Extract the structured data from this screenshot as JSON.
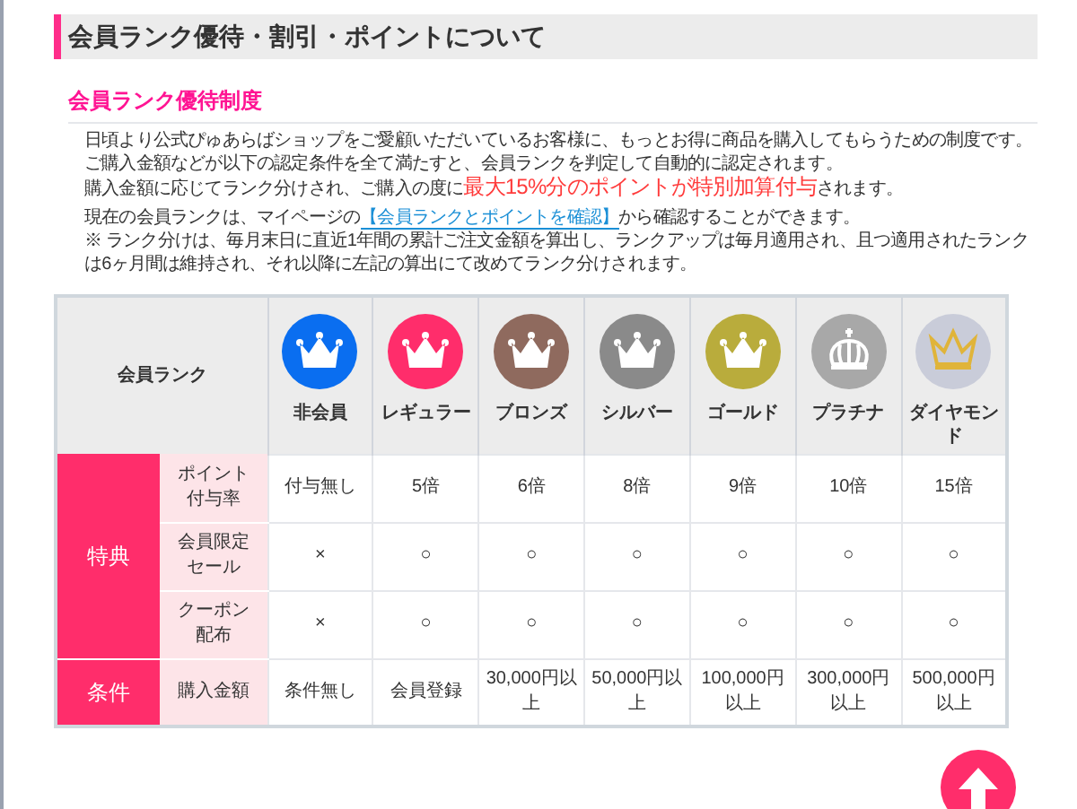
{
  "page_title": "会員ランク優待・割引・ポイントについて",
  "section_heading": "会員ランク優待制度",
  "paragraphs": [
    {
      "kind": "plain",
      "text": "日頃より公式ぴゅあらばショップをご愛顧いただいているお客様に、もっとお得に商品を購入してもらうための制度です。"
    },
    {
      "kind": "plain",
      "text": "ご購入金額などが以下の認定条件を全て満たすと、会員ランクを判定して自動的に認定されます。"
    },
    {
      "kind": "highlight",
      "before": "購入金額に応じてランク分けされ、ご購入の度に",
      "highlight": "最大15%分のポイントが特別加算付与",
      "after": "されます。"
    },
    {
      "kind": "link",
      "before": "現在の会員ランクは、マイページの",
      "link": "【会員ランクとポイントを確認】",
      "after": "から確認することができます。"
    },
    {
      "kind": "plain",
      "text": "※ ランク分けは、毎月末日に直近1年間の累計ご注文金額を算出し、ランクアップは毎月適用され、且つ適用されたランクは6ヶ月間は維持され、それ以降に左記の算出にて改めてランク分けされます。"
    }
  ],
  "table": {
    "corner": "会員ランク",
    "ranks": [
      {
        "name": "非会員",
        "color": "#0a6ef0",
        "kind": "crown"
      },
      {
        "name": "レギュラー",
        "color": "#ff2d6b",
        "kind": "crown"
      },
      {
        "name": "ブロンズ",
        "color": "#8f6a5e",
        "kind": "crown"
      },
      {
        "name": "シルバー",
        "color": "#8a8a8a",
        "kind": "crown"
      },
      {
        "name": "ゴールド",
        "color": "#b9ac3c",
        "kind": "crown"
      },
      {
        "name": "プラチナ",
        "color": "#a8a8a8",
        "kind": "royal-crown"
      },
      {
        "name": "ダイヤモンド",
        "color": "#c9ccd9",
        "kind": "gold-crown"
      }
    ],
    "groups": [
      {
        "label": "特典",
        "rows": [
          {
            "label": "ポイント付与率",
            "cells": [
              "付与無し",
              "5倍",
              "6倍",
              "8倍",
              "9倍",
              "10倍",
              "15倍"
            ]
          },
          {
            "label": "会員限定セール",
            "cells": [
              "×",
              "○",
              "○",
              "○",
              "○",
              "○",
              "○"
            ]
          },
          {
            "label": "クーポン配布",
            "cells": [
              "×",
              "○",
              "○",
              "○",
              "○",
              "○",
              "○"
            ]
          }
        ]
      },
      {
        "label": "条件",
        "rows": [
          {
            "label": "購入金額",
            "cells": [
              "条件無し",
              "会員登録",
              "30,000円以上",
              "50,000円以上",
              "100,000円以上",
              "300,000円以上",
              "500,000円以上"
            ]
          }
        ]
      }
    ]
  }
}
